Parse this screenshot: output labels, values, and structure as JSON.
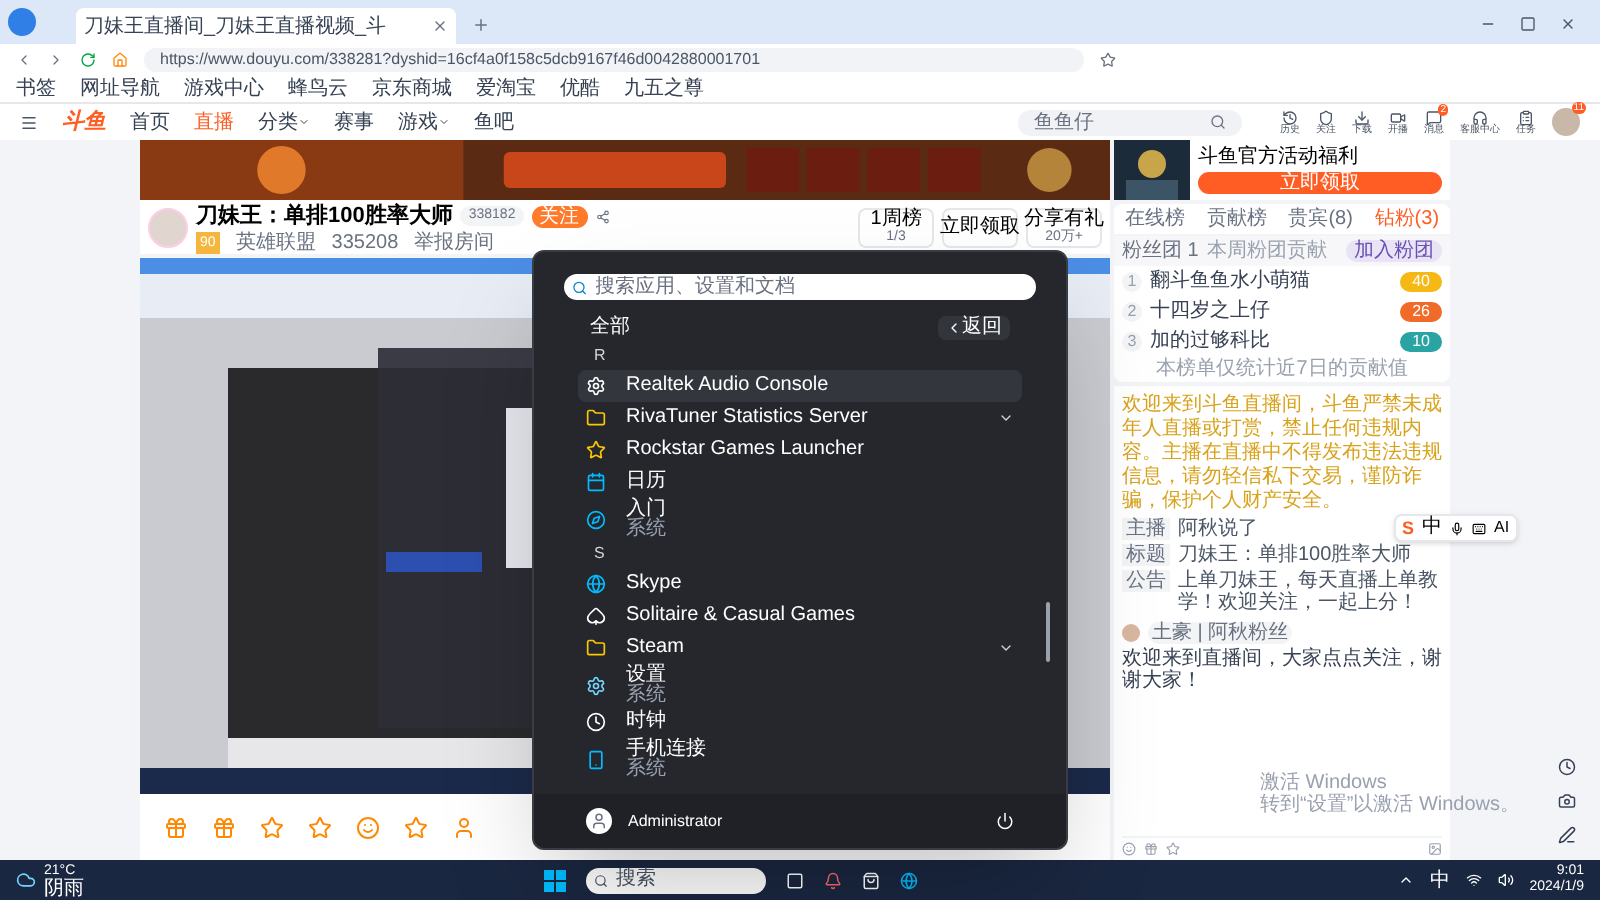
{
  "browser": {
    "tab_title": "刀妹王直播间_刀妹王直播视频_斗",
    "url": "https://www.douyu.com/338281?dyshid=16cf4a0f158c5dcb9167f46d0042880001701",
    "bookmarks": [
      "书签",
      "网址导航",
      "游戏中心",
      "蜂鸟云",
      "京东商城",
      "爱淘宝",
      "优酷",
      "九五之尊"
    ]
  },
  "site": {
    "logo": "斗鱼",
    "nav": [
      {
        "label": "首页",
        "selected": false,
        "dropdown": false
      },
      {
        "label": "直播",
        "selected": true,
        "dropdown": false
      },
      {
        "label": "分类",
        "selected": false,
        "dropdown": true
      },
      {
        "label": "赛事",
        "selected": false,
        "dropdown": false
      },
      {
        "label": "游戏",
        "selected": false,
        "dropdown": true
      },
      {
        "label": "鱼吧",
        "selected": false,
        "dropdown": false
      }
    ],
    "search": {
      "value": "鱼鱼仔"
    },
    "actions": [
      "历史",
      "关注",
      "下载",
      "开播",
      "消息",
      "客服中心",
      "任务"
    ],
    "message_badge": "2",
    "avatar_badge": "11"
  },
  "streamer": {
    "title": "刀妹王：单排100胜率大师",
    "room": "338182",
    "follow": "关注",
    "level": "90",
    "category": "英雄联盟",
    "heat": "335208",
    "report": "举报房间",
    "stats": [
      {
        "top": "1周榜",
        "bottom": "1/3"
      },
      {
        "top": "立即领取"
      },
      {
        "top": "分享有礼",
        "bottom": "20万+"
      }
    ]
  },
  "ad": {
    "text": "斗鱼官方活动福利",
    "button": "立即领取"
  },
  "panel": {
    "tabs": [
      {
        "label": "在线榜",
        "selected": false
      },
      {
        "label": "贡献榜",
        "selected": false
      },
      {
        "label": "贵宾(8)",
        "selected": false
      },
      {
        "label": "钻粉(3)",
        "selected": true
      }
    ],
    "fan_row": {
      "label": "粉丝团 1",
      "info": "本周粉团贡献",
      "button": "加入粉团"
    },
    "ranking": [
      {
        "rank": "1",
        "name": "翻斗鱼鱼水小萌猫",
        "level": "40",
        "color": "#f5b814"
      },
      {
        "rank": "2",
        "name": "十四岁之上仔",
        "level": "26",
        "color": "#f06a2a"
      },
      {
        "rank": "3",
        "name": "加的过够科比",
        "level": "10",
        "color": "#2aa3a3"
      }
    ],
    "footer": "本榜单仅统计近7日的贡献值",
    "notice": "欢迎来到斗鱼直播间，斗鱼严禁未成年人直播或打赏，禁止任何违规内容。主播在直播中不得发布违法违规信息，请勿轻信私下交易，谨防诈骗，保护个人财产安全。",
    "info": [
      {
        "tag": "主播",
        "text": "阿秋说了"
      },
      {
        "tag": "标题",
        "text": "刀妹王：单排100胜率大师"
      },
      {
        "tag": "公告",
        "text": "上单刀妹王，每天直播上单教学！欢迎关注，一起上分！"
      }
    ],
    "chat": {
      "badge": "土豪 | 阿秋粉丝",
      "message": "欢迎来到直播间，大家点点关注，谢谢大家！"
    }
  },
  "ime": {
    "logo": "S",
    "mode": "中",
    "label": "AI"
  },
  "activation": {
    "title": "激活 Windows",
    "sub": "转到“设置”以激活 Windows。"
  },
  "start_menu": {
    "search": {
      "placeholder": "搜索应用、设置和文档"
    },
    "heading": "全部",
    "back": "返回",
    "sections": [
      {
        "letter": "R",
        "items": [
          {
            "name": "Realtek Audio Console",
            "kind": "app",
            "selected": true
          },
          {
            "name": "RivaTuner Statistics Server",
            "kind": "folder",
            "selected": false
          },
          {
            "name": "Rockstar Games Launcher",
            "kind": "app",
            "selected": false
          },
          {
            "name": "日历",
            "kind": "app",
            "selected": false
          },
          {
            "name": "入门",
            "sub": "系统",
            "kind": "app",
            "selected": false
          }
        ]
      },
      {
        "letter": "S",
        "items": [
          {
            "name": "Skype",
            "kind": "app",
            "selected": false
          },
          {
            "name": "Solitaire & Casual Games",
            "kind": "app",
            "selected": false
          },
          {
            "name": "Steam",
            "kind": "folder",
            "selected": false
          },
          {
            "name": "设置",
            "sub": "系统",
            "kind": "app",
            "selected": false
          },
          {
            "name": "时钟",
            "kind": "app",
            "selected": false
          },
          {
            "name": "手机连接",
            "sub": "系统",
            "kind": "app",
            "selected": false
          }
        ]
      }
    ],
    "user": "Administrator"
  },
  "taskbar": {
    "weather": {
      "temp": "21°C",
      "text": "阴雨"
    },
    "search": "搜索",
    "ime": "中",
    "time": "9:01",
    "date": "2024/1/9"
  }
}
